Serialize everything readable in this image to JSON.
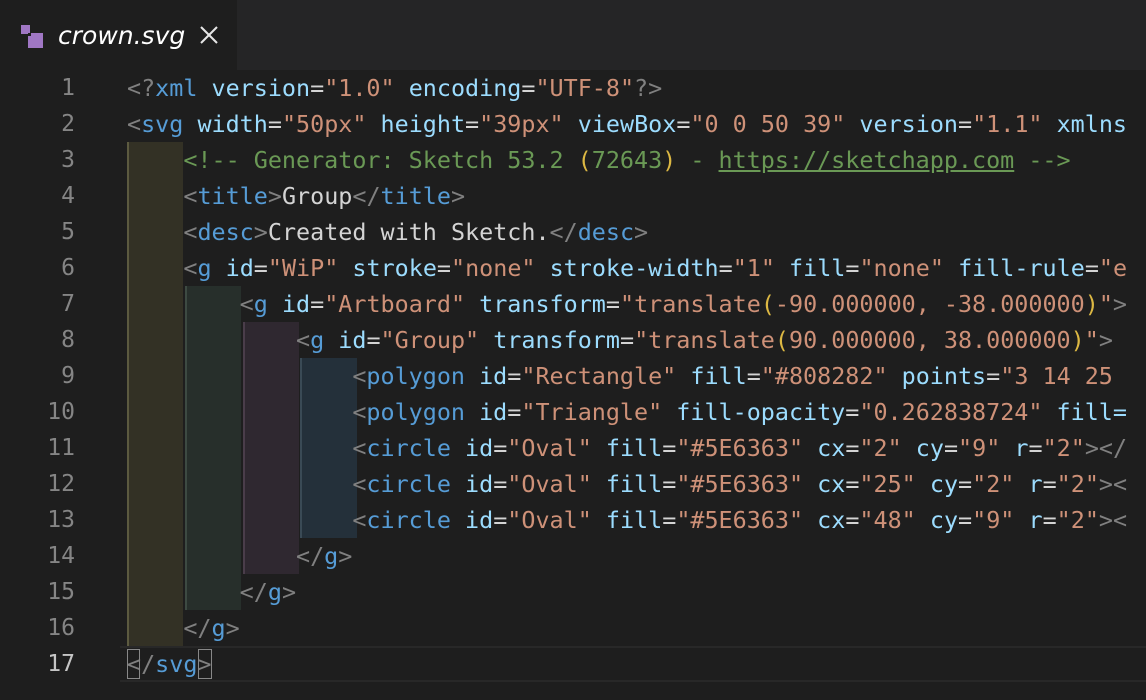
{
  "tab": {
    "title": "crown.svg",
    "file_icon": "svg-file-icon",
    "close_icon": "close-icon"
  },
  "colors": {
    "background": "#1e1e1e",
    "tabbar": "#252526",
    "line_number": "#858585",
    "line_number_active": "#c6c6c6",
    "punctuation": "#808080",
    "tag": "#569cd6",
    "attribute": "#9cdcfe",
    "string": "#ce9178",
    "comment": "#6a9955",
    "bracket": "#dcb843",
    "text": "#d4d4d4",
    "indent_level_1": "#333125",
    "indent_level_2": "#272f2b",
    "indent_level_3": "#2f2830",
    "indent_level_4": "#24303a"
  },
  "editor": {
    "active_line": 17,
    "lines": [
      {
        "n": "1",
        "tokens": [
          [
            "p",
            "<?"
          ],
          [
            "t",
            "xml"
          ],
          [
            "w",
            " "
          ],
          [
            "a",
            "version"
          ],
          [
            "w",
            "="
          ],
          [
            "s",
            "\"1.0\""
          ],
          [
            "w",
            " "
          ],
          [
            "a",
            "encoding"
          ],
          [
            "w",
            "="
          ],
          [
            "s",
            "\"UTF-8\""
          ],
          [
            "p",
            "?>"
          ]
        ]
      },
      {
        "n": "2",
        "tokens": [
          [
            "p",
            "<"
          ],
          [
            "t",
            "svg"
          ],
          [
            "w",
            " "
          ],
          [
            "a",
            "width"
          ],
          [
            "w",
            "="
          ],
          [
            "s",
            "\"50px\""
          ],
          [
            "w",
            " "
          ],
          [
            "a",
            "height"
          ],
          [
            "w",
            "="
          ],
          [
            "s",
            "\"39px\""
          ],
          [
            "w",
            " "
          ],
          [
            "a",
            "viewBox"
          ],
          [
            "w",
            "="
          ],
          [
            "s",
            "\"0 0 50 39\""
          ],
          [
            "w",
            " "
          ],
          [
            "a",
            "version"
          ],
          [
            "w",
            "="
          ],
          [
            "s",
            "\"1.1\""
          ],
          [
            "w",
            " "
          ],
          [
            "a",
            "xmlns"
          ]
        ]
      },
      {
        "n": "3",
        "tokens": [
          [
            "w",
            "    "
          ],
          [
            "c",
            "<!-- Generator: Sketch 53.2 "
          ],
          [
            "y",
            "("
          ],
          [
            "c",
            "72643"
          ],
          [
            "y",
            ")"
          ],
          [
            "c",
            " - "
          ],
          [
            "u",
            "https://sketchapp.com"
          ],
          [
            "c",
            " -->"
          ]
        ]
      },
      {
        "n": "4",
        "tokens": [
          [
            "w",
            "    "
          ],
          [
            "p",
            "<"
          ],
          [
            "t",
            "title"
          ],
          [
            "p",
            ">"
          ],
          [
            "w",
            "Group"
          ],
          [
            "p",
            "</"
          ],
          [
            "t",
            "title"
          ],
          [
            "p",
            ">"
          ]
        ]
      },
      {
        "n": "5",
        "tokens": [
          [
            "w",
            "    "
          ],
          [
            "p",
            "<"
          ],
          [
            "t",
            "desc"
          ],
          [
            "p",
            ">"
          ],
          [
            "w",
            "Created with Sketch."
          ],
          [
            "p",
            "</"
          ],
          [
            "t",
            "desc"
          ],
          [
            "p",
            ">"
          ]
        ]
      },
      {
        "n": "6",
        "tokens": [
          [
            "w",
            "    "
          ],
          [
            "p",
            "<"
          ],
          [
            "t",
            "g"
          ],
          [
            "w",
            " "
          ],
          [
            "a",
            "id"
          ],
          [
            "w",
            "="
          ],
          [
            "s",
            "\"WiP\""
          ],
          [
            "w",
            " "
          ],
          [
            "a",
            "stroke"
          ],
          [
            "w",
            "="
          ],
          [
            "s",
            "\"none\""
          ],
          [
            "w",
            " "
          ],
          [
            "a",
            "stroke-width"
          ],
          [
            "w",
            "="
          ],
          [
            "s",
            "\"1\""
          ],
          [
            "w",
            " "
          ],
          [
            "a",
            "fill"
          ],
          [
            "w",
            "="
          ],
          [
            "s",
            "\"none\""
          ],
          [
            "w",
            " "
          ],
          [
            "a",
            "fill-rule"
          ],
          [
            "w",
            "="
          ],
          [
            "s",
            "\"e"
          ]
        ]
      },
      {
        "n": "7",
        "tokens": [
          [
            "w",
            "        "
          ],
          [
            "p",
            "<"
          ],
          [
            "t",
            "g"
          ],
          [
            "w",
            " "
          ],
          [
            "a",
            "id"
          ],
          [
            "w",
            "="
          ],
          [
            "s",
            "\"Artboard\""
          ],
          [
            "w",
            " "
          ],
          [
            "a",
            "transform"
          ],
          [
            "w",
            "="
          ],
          [
            "s",
            "\"translate"
          ],
          [
            "y",
            "("
          ],
          [
            "s",
            "-90.000000, -38.000000"
          ],
          [
            "y",
            ")"
          ],
          [
            "s",
            "\""
          ],
          [
            "p",
            ">"
          ]
        ]
      },
      {
        "n": "8",
        "tokens": [
          [
            "w",
            "            "
          ],
          [
            "p",
            "<"
          ],
          [
            "t",
            "g"
          ],
          [
            "w",
            " "
          ],
          [
            "a",
            "id"
          ],
          [
            "w",
            "="
          ],
          [
            "s",
            "\"Group\""
          ],
          [
            "w",
            " "
          ],
          [
            "a",
            "transform"
          ],
          [
            "w",
            "="
          ],
          [
            "s",
            "\"translate"
          ],
          [
            "y",
            "("
          ],
          [
            "s",
            "90.000000, 38.000000"
          ],
          [
            "y",
            ")"
          ],
          [
            "s",
            "\""
          ],
          [
            "p",
            ">"
          ]
        ]
      },
      {
        "n": "9",
        "tokens": [
          [
            "w",
            "                "
          ],
          [
            "p",
            "<"
          ],
          [
            "t",
            "polygon"
          ],
          [
            "w",
            " "
          ],
          [
            "a",
            "id"
          ],
          [
            "w",
            "="
          ],
          [
            "s",
            "\"Rectangle\""
          ],
          [
            "w",
            " "
          ],
          [
            "a",
            "fill"
          ],
          [
            "w",
            "="
          ],
          [
            "s",
            "\"#808282\""
          ],
          [
            "w",
            " "
          ],
          [
            "a",
            "points"
          ],
          [
            "w",
            "="
          ],
          [
            "s",
            "\"3 14 25"
          ]
        ]
      },
      {
        "n": "10",
        "tokens": [
          [
            "w",
            "                "
          ],
          [
            "p",
            "<"
          ],
          [
            "t",
            "polygon"
          ],
          [
            "w",
            " "
          ],
          [
            "a",
            "id"
          ],
          [
            "w",
            "="
          ],
          [
            "s",
            "\"Triangle\""
          ],
          [
            "w",
            " "
          ],
          [
            "a",
            "fill-opacity"
          ],
          [
            "w",
            "="
          ],
          [
            "s",
            "\"0.262838724\""
          ],
          [
            "w",
            " "
          ],
          [
            "a",
            "fill="
          ]
        ]
      },
      {
        "n": "11",
        "tokens": [
          [
            "w",
            "                "
          ],
          [
            "p",
            "<"
          ],
          [
            "t",
            "circle"
          ],
          [
            "w",
            " "
          ],
          [
            "a",
            "id"
          ],
          [
            "w",
            "="
          ],
          [
            "s",
            "\"Oval\""
          ],
          [
            "w",
            " "
          ],
          [
            "a",
            "fill"
          ],
          [
            "w",
            "="
          ],
          [
            "s",
            "\"#5E6363\""
          ],
          [
            "w",
            " "
          ],
          [
            "a",
            "cx"
          ],
          [
            "w",
            "="
          ],
          [
            "s",
            "\"2\""
          ],
          [
            "w",
            " "
          ],
          [
            "a",
            "cy"
          ],
          [
            "w",
            "="
          ],
          [
            "s",
            "\"9\""
          ],
          [
            "w",
            " "
          ],
          [
            "a",
            "r"
          ],
          [
            "w",
            "="
          ],
          [
            "s",
            "\"2\""
          ],
          [
            "p",
            "></"
          ]
        ]
      },
      {
        "n": "12",
        "tokens": [
          [
            "w",
            "                "
          ],
          [
            "p",
            "<"
          ],
          [
            "t",
            "circle"
          ],
          [
            "w",
            " "
          ],
          [
            "a",
            "id"
          ],
          [
            "w",
            "="
          ],
          [
            "s",
            "\"Oval\""
          ],
          [
            "w",
            " "
          ],
          [
            "a",
            "fill"
          ],
          [
            "w",
            "="
          ],
          [
            "s",
            "\"#5E6363\""
          ],
          [
            "w",
            " "
          ],
          [
            "a",
            "cx"
          ],
          [
            "w",
            "="
          ],
          [
            "s",
            "\"25\""
          ],
          [
            "w",
            " "
          ],
          [
            "a",
            "cy"
          ],
          [
            "w",
            "="
          ],
          [
            "s",
            "\"2\""
          ],
          [
            "w",
            " "
          ],
          [
            "a",
            "r"
          ],
          [
            "w",
            "="
          ],
          [
            "s",
            "\"2\""
          ],
          [
            "p",
            "><"
          ]
        ]
      },
      {
        "n": "13",
        "tokens": [
          [
            "w",
            "                "
          ],
          [
            "p",
            "<"
          ],
          [
            "t",
            "circle"
          ],
          [
            "w",
            " "
          ],
          [
            "a",
            "id"
          ],
          [
            "w",
            "="
          ],
          [
            "s",
            "\"Oval\""
          ],
          [
            "w",
            " "
          ],
          [
            "a",
            "fill"
          ],
          [
            "w",
            "="
          ],
          [
            "s",
            "\"#5E6363\""
          ],
          [
            "w",
            " "
          ],
          [
            "a",
            "cx"
          ],
          [
            "w",
            "="
          ],
          [
            "s",
            "\"48\""
          ],
          [
            "w",
            " "
          ],
          [
            "a",
            "cy"
          ],
          [
            "w",
            "="
          ],
          [
            "s",
            "\"9\""
          ],
          [
            "w",
            " "
          ],
          [
            "a",
            "r"
          ],
          [
            "w",
            "="
          ],
          [
            "s",
            "\"2\""
          ],
          [
            "p",
            "><"
          ]
        ]
      },
      {
        "n": "14",
        "tokens": [
          [
            "w",
            "            "
          ],
          [
            "p",
            "</"
          ],
          [
            "t",
            "g"
          ],
          [
            "p",
            ">"
          ]
        ]
      },
      {
        "n": "15",
        "tokens": [
          [
            "w",
            "        "
          ],
          [
            "p",
            "</"
          ],
          [
            "t",
            "g"
          ],
          [
            "p",
            ">"
          ]
        ]
      },
      {
        "n": "16",
        "tokens": [
          [
            "w",
            "    "
          ],
          [
            "p",
            "</"
          ],
          [
            "t",
            "g"
          ],
          [
            "p",
            ">"
          ]
        ]
      },
      {
        "n": "17",
        "tokens": [
          [
            "p",
            "</"
          ],
          [
            "t",
            "svg"
          ],
          [
            "p",
            ">"
          ]
        ]
      }
    ]
  }
}
